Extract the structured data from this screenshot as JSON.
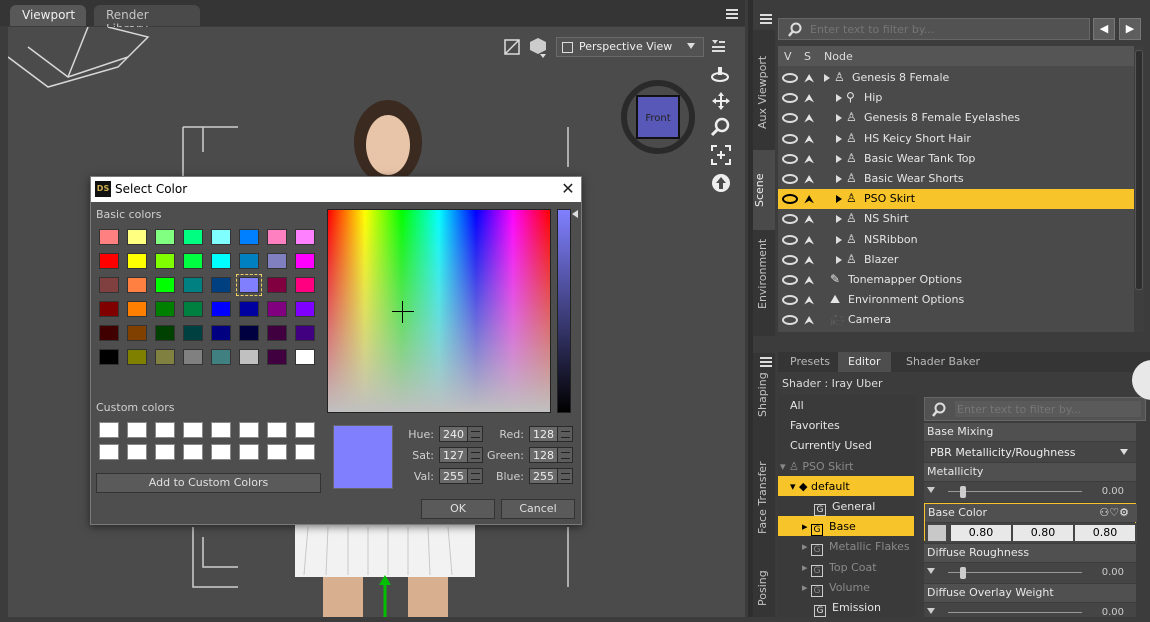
{
  "tabs": {
    "viewport": "Viewport",
    "render_library": "Render Library"
  },
  "viewport": {
    "view_select": "Perspective View",
    "cube_label": "Front"
  },
  "dialog": {
    "title": "Select Color",
    "logo": "DS",
    "basic_colors_label": "Basic colors",
    "custom_colors_label": "Custom colors",
    "add_custom_label": "Add to Custom Colors",
    "basic_colors": [
      [
        "#ff8080",
        "#ffff80",
        "#80ff80",
        "#00ff80",
        "#80ffff",
        "#0080ff",
        "#ff80c0",
        "#ff80ff"
      ],
      [
        "#ff0000",
        "#ffff00",
        "#80ff00",
        "#00ff40",
        "#00ffff",
        "#0080c0",
        "#8080c0",
        "#ff00ff"
      ],
      [
        "#804040",
        "#ff8040",
        "#00ff00",
        "#008080",
        "#004080",
        "#8080ff",
        "#800040",
        "#ff0080"
      ],
      [
        "#800000",
        "#ff8000",
        "#008000",
        "#008040",
        "#0000ff",
        "#0000a0",
        "#800080",
        "#8000ff"
      ],
      [
        "#400000",
        "#804000",
        "#004000",
        "#004040",
        "#000080",
        "#000040",
        "#400040",
        "#400080"
      ],
      [
        "#000000",
        "#808000",
        "#808040",
        "#808080",
        "#408080",
        "#c0c0c0",
        "#400040",
        "#ffffff"
      ]
    ],
    "selected_color": "#8080ff",
    "hue": {
      "label": "Hue:",
      "value": "240"
    },
    "sat": {
      "label": "Sat:",
      "value": "127"
    },
    "val": {
      "label": "Val:",
      "value": "255"
    },
    "red": {
      "label": "Red:",
      "value": "128"
    },
    "green": {
      "label": "Green:",
      "value": "128"
    },
    "blue": {
      "label": "Blue:",
      "value": "255"
    },
    "ok_label": "OK",
    "cancel_label": "Cancel"
  },
  "scene": {
    "side_tabs": [
      "Aux Viewport",
      "Scene",
      "Environment"
    ],
    "filter_placeholder": "Enter text to filter by...",
    "header": {
      "v": "V",
      "s": "S",
      "node": "Node"
    },
    "nodes": [
      {
        "label": "Genesis 8 Female",
        "icon": "figure-icon"
      },
      {
        "label": "Hip",
        "icon": "bone-icon"
      },
      {
        "label": "Genesis 8 Female Eyelashes",
        "icon": "figure-icon"
      },
      {
        "label": "HS Keicy Short Hair",
        "icon": "figure-icon"
      },
      {
        "label": "Basic Wear Tank Top",
        "icon": "figure-icon"
      },
      {
        "label": "Basic Wear Shorts",
        "icon": "figure-icon"
      },
      {
        "label": "PSO Skirt",
        "icon": "figure-icon"
      },
      {
        "label": "NS Shirt",
        "icon": "figure-icon"
      },
      {
        "label": "NSRibbon",
        "icon": "figure-icon"
      },
      {
        "label": "Blazer",
        "icon": "figure-icon"
      },
      {
        "label": "Tonemapper Options",
        "icon": "tonemapper-icon"
      },
      {
        "label": "Environment Options",
        "icon": "environment-icon"
      },
      {
        "label": "Camera",
        "icon": "camera-icon"
      }
    ]
  },
  "surfaces": {
    "side_tabs": [
      "Shaping",
      "Face Transfer",
      "Posing"
    ],
    "tabs": [
      "Presets",
      "Editor",
      "Shader Baker"
    ],
    "shader_line": "Shader : Iray Uber",
    "categories": [
      "All",
      "Favorites",
      "Currently Used",
      "PSO Skirt",
      "default",
      "General",
      "Base",
      "Metallic Flakes",
      "Top Coat",
      "Volume",
      "Emission"
    ],
    "filter_placeholder": "Enter text to filter by...",
    "base_mixing": {
      "label": "Base Mixing",
      "value": "PBR Metallicity/Roughness"
    },
    "metallicity": {
      "label": "Metallicity",
      "value": "0.00"
    },
    "base_color": {
      "label": "Base Color",
      "r": "0.80",
      "g": "0.80",
      "b": "0.80"
    },
    "diffuse_roughness": {
      "label": "Diffuse Roughness",
      "value": "0.00"
    },
    "diffuse_overlay": {
      "label": "Diffuse Overlay Weight",
      "value": "0.00"
    }
  }
}
